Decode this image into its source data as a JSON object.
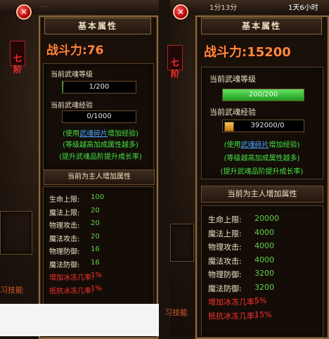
{
  "left": {
    "top_text": "...",
    "close_symbol": "✕",
    "rank_text": "七\n阶",
    "header_title": "基本属性",
    "combat_label": "战斗力:",
    "combat_value": "76",
    "soul_level_label": "当前武魂等级",
    "soul_level_value": "1/200",
    "soul_level_progress": 0.005,
    "soul_exp_label": "当前武魂经验",
    "soul_exp_value": "0/1000",
    "soul_exp_progress": 0,
    "hint1_a": "(使用",
    "hint1_link": "武魂碎片",
    "hint1_b": "增加经验)",
    "hint2": "(等级越高加成属性越多)",
    "hint3": "(提升武魂品阶提升成长率)",
    "section_title": "当前为主人增加属性",
    "stats": [
      {
        "label": "生命上限:",
        "value": "100",
        "tone": "normal"
      },
      {
        "label": "魔法上限:",
        "value": "20",
        "tone": "normal"
      },
      {
        "label": "物理攻击:",
        "value": "20",
        "tone": "normal"
      },
      {
        "label": "魔法攻击:",
        "value": "20",
        "tone": "normal"
      },
      {
        "label": "物理防御:",
        "value": "16",
        "tone": "normal"
      },
      {
        "label": "魔法防御:",
        "value": "16",
        "tone": "normal"
      },
      {
        "label": "增加冰冻几率:",
        "value": "1%",
        "tone": "red"
      },
      {
        "label": "抵抗冰冻几率:",
        "value": "1%",
        "tone": "red"
      }
    ],
    "side_text": "习技能"
  },
  "right": {
    "top_text": "1分13分",
    "top_right": "1天6小时",
    "close_symbol": "✕",
    "rank_text": "七\n阶",
    "header_title": "基本属性",
    "combat_label": "战斗力:",
    "combat_value": "15200",
    "soul_level_label": "当前武魂等级",
    "soul_level_value": "200/200",
    "soul_level_progress": 1,
    "soul_exp_label": "当前武魂经验",
    "soul_exp_value": "392000/0",
    "soul_exp_progress": 0,
    "hint1_a": "(使用",
    "hint1_link": "武魂碎片",
    "hint1_b": "增加经验)",
    "hint2": "(等级越高加成属性越多)",
    "hint3": "(提升武魂品阶提升成长率)",
    "section_title": "当前为主人增加属性",
    "stats": [
      {
        "label": "生命上限:",
        "value": "20000",
        "tone": "normal"
      },
      {
        "label": "魔法上限:",
        "value": "4000",
        "tone": "normal"
      },
      {
        "label": "物理攻击:",
        "value": "4000",
        "tone": "normal"
      },
      {
        "label": "魔法攻击:",
        "value": "4000",
        "tone": "normal"
      },
      {
        "label": "物理防御:",
        "value": "3200",
        "tone": "normal"
      },
      {
        "label": "魔法防御:",
        "value": "3200",
        "tone": "normal"
      },
      {
        "label": "增加冰冻几率:",
        "value": "5%",
        "tone": "red"
      },
      {
        "label": "抵抗冰冻几率:",
        "value": "15%",
        "tone": "red"
      }
    ],
    "side_text": "习技能"
  },
  "colors": {
    "accent_orange": "#ff8a3d",
    "value_green": "#5fd14b",
    "warning_red": "#ff3030",
    "hint_green": "#44e244",
    "link_blue": "#4aa7ff"
  }
}
